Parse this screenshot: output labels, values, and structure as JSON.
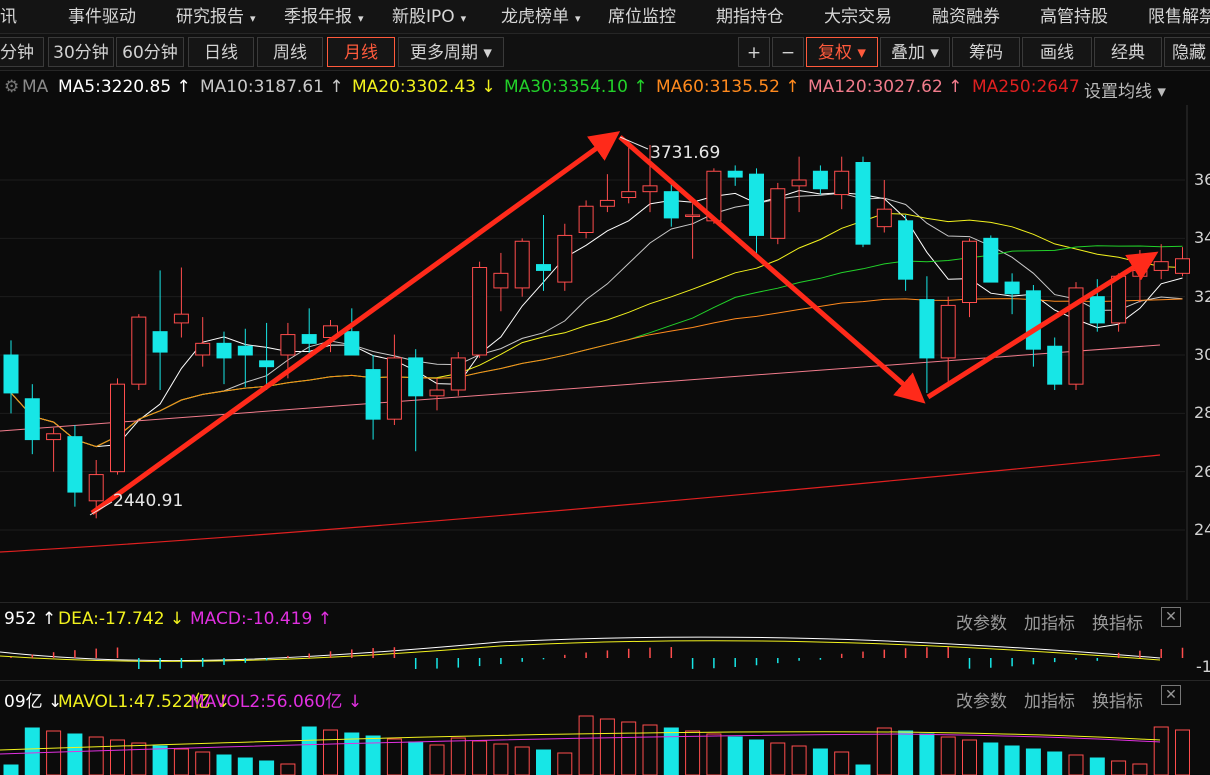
{
  "nav": {
    "items": [
      "讯",
      "事件驱动",
      "研究报告",
      "季报年报",
      "新股IPO",
      "龙虎榜单",
      "席位监控",
      "期指持仓",
      "大宗交易",
      "融资融券",
      "高管持股",
      "限售解禁"
    ],
    "dropdown_marker": "▾"
  },
  "toolbar": {
    "periods": [
      "分钟",
      "30分钟",
      "60分钟",
      "日线",
      "周线",
      "月线",
      "更多周期 ▾"
    ],
    "active_period": "月线",
    "right_buttons": [
      "+",
      "−",
      "复权 ▾",
      "叠加 ▾",
      "筹码",
      "画线",
      "经典",
      "隐藏"
    ]
  },
  "ma": {
    "label": "MA",
    "items": [
      {
        "text": "MA5:3220.85",
        "arrow": "↑",
        "color": "#ffffff"
      },
      {
        "text": "MA10:3187.61",
        "arrow": "↑",
        "color": "#c8c8c8"
      },
      {
        "text": "MA20:3302.43",
        "arrow": "↓",
        "color": "#f2f21e"
      },
      {
        "text": "MA30:3354.10",
        "arrow": "↑",
        "color": "#22d12a"
      },
      {
        "text": "MA60:3135.52",
        "arrow": "↑",
        "color": "#ff8a1e"
      },
      {
        "text": "MA120:3027.62",
        "arrow": "↑",
        "color": "#f27c8c"
      },
      {
        "text": "MA250:2647",
        "arrow": "",
        "color": "#e02020"
      }
    ],
    "settings": "设置均线 ▾"
  },
  "chart_data": {
    "type": "candlestick",
    "y_ticks": [
      "36",
      "34",
      "32",
      "30",
      "28",
      "26",
      "24"
    ],
    "high_label": "3731.69",
    "low_label": "2440.91",
    "up_color": "#ff4d4d",
    "down_color": "#17e6e6",
    "candles": [
      {
        "o": 3000,
        "h": 3050,
        "l": 2800,
        "c": 2870
      },
      {
        "o": 2850,
        "h": 2900,
        "l": 2660,
        "c": 2710
      },
      {
        "o": 2710,
        "h": 2750,
        "l": 2600,
        "c": 2730
      },
      {
        "o": 2720,
        "h": 2760,
        "l": 2480,
        "c": 2530
      },
      {
        "o": 2500,
        "h": 2640,
        "l": 2440,
        "c": 2590
      },
      {
        "o": 2600,
        "h": 2920,
        "l": 2590,
        "c": 2900
      },
      {
        "o": 2900,
        "h": 3140,
        "l": 2880,
        "c": 3130
      },
      {
        "o": 3080,
        "h": 3290,
        "l": 2880,
        "c": 3010
      },
      {
        "o": 3110,
        "h": 3300,
        "l": 3060,
        "c": 3140
      },
      {
        "o": 3000,
        "h": 3130,
        "l": 2960,
        "c": 3040
      },
      {
        "o": 3040,
        "h": 3080,
        "l": 2900,
        "c": 2990
      },
      {
        "o": 3030,
        "h": 3090,
        "l": 2890,
        "c": 3000
      },
      {
        "o": 2980,
        "h": 3110,
        "l": 2880,
        "c": 2960
      },
      {
        "o": 3000,
        "h": 3110,
        "l": 2920,
        "c": 3070
      },
      {
        "o": 3070,
        "h": 3160,
        "l": 3000,
        "c": 3040
      },
      {
        "o": 3060,
        "h": 3120,
        "l": 3010,
        "c": 3100
      },
      {
        "o": 3080,
        "h": 3160,
        "l": 3000,
        "c": 3000
      },
      {
        "o": 2950,
        "h": 3000,
        "l": 2710,
        "c": 2780
      },
      {
        "o": 2780,
        "h": 3070,
        "l": 2760,
        "c": 2990
      },
      {
        "o": 2990,
        "h": 3020,
        "l": 2670,
        "c": 2860
      },
      {
        "o": 2860,
        "h": 2920,
        "l": 2810,
        "c": 2880
      },
      {
        "o": 2880,
        "h": 3010,
        "l": 2860,
        "c": 2990
      },
      {
        "o": 3000,
        "h": 3320,
        "l": 2990,
        "c": 3300
      },
      {
        "o": 3230,
        "h": 3350,
        "l": 3150,
        "c": 3280
      },
      {
        "o": 3230,
        "h": 3400,
        "l": 3200,
        "c": 3390
      },
      {
        "o": 3310,
        "h": 3480,
        "l": 3220,
        "c": 3290
      },
      {
        "o": 3250,
        "h": 3450,
        "l": 3220,
        "c": 3410
      },
      {
        "o": 3420,
        "h": 3530,
        "l": 3400,
        "c": 3510
      },
      {
        "o": 3510,
        "h": 3620,
        "l": 3490,
        "c": 3530
      },
      {
        "o": 3540,
        "h": 3730,
        "l": 3520,
        "c": 3560
      },
      {
        "o": 3560,
        "h": 3720,
        "l": 3490,
        "c": 3580
      },
      {
        "o": 3560,
        "h": 3600,
        "l": 3440,
        "c": 3470
      },
      {
        "o": 3480,
        "h": 3520,
        "l": 3330,
        "c": 3480
      },
      {
        "o": 3460,
        "h": 3640,
        "l": 3450,
        "c": 3630
      },
      {
        "o": 3630,
        "h": 3650,
        "l": 3580,
        "c": 3610
      },
      {
        "o": 3620,
        "h": 3640,
        "l": 3340,
        "c": 3410
      },
      {
        "o": 3400,
        "h": 3590,
        "l": 3380,
        "c": 3570
      },
      {
        "o": 3580,
        "h": 3680,
        "l": 3490,
        "c": 3600
      },
      {
        "o": 3630,
        "h": 3650,
        "l": 3550,
        "c": 3570
      },
      {
        "o": 3550,
        "h": 3680,
        "l": 3500,
        "c": 3630
      },
      {
        "o": 3660,
        "h": 3680,
        "l": 3370,
        "c": 3380
      },
      {
        "o": 3440,
        "h": 3600,
        "l": 3420,
        "c": 3500
      },
      {
        "o": 3460,
        "h": 3480,
        "l": 3220,
        "c": 3260
      },
      {
        "o": 3190,
        "h": 3270,
        "l": 2870,
        "c": 2990
      },
      {
        "o": 2990,
        "h": 3200,
        "l": 2890,
        "c": 3170
      },
      {
        "o": 3180,
        "h": 3400,
        "l": 3130,
        "c": 3390
      },
      {
        "o": 3400,
        "h": 3410,
        "l": 3260,
        "c": 3250
      },
      {
        "o": 3250,
        "h": 3280,
        "l": 3140,
        "c": 3210
      },
      {
        "o": 3220,
        "h": 3240,
        "l": 2960,
        "c": 3020
      },
      {
        "o": 3030,
        "h": 3060,
        "l": 2880,
        "c": 2900
      },
      {
        "o": 2900,
        "h": 3250,
        "l": 2880,
        "c": 3230
      },
      {
        "o": 3200,
        "h": 3260,
        "l": 3080,
        "c": 3110
      },
      {
        "o": 3110,
        "h": 3280,
        "l": 3080,
        "c": 3270
      },
      {
        "o": 3270,
        "h": 3360,
        "l": 3180,
        "c": 3290
      },
      {
        "o": 3290,
        "h": 3380,
        "l": 3260,
        "c": 3320
      },
      {
        "o": 3280,
        "h": 3370,
        "l": 3270,
        "c": 3330
      }
    ]
  },
  "macd": {
    "items": [
      {
        "text": "952",
        "arrow": "↑",
        "color": "#ffffff"
      },
      {
        "text": "DEA:-17.742",
        "arrow": "↓",
        "color": "#f2f21e"
      },
      {
        "text": "MACD:-10.419",
        "arrow": "↑",
        "color": "#e030e0"
      }
    ],
    "buttons": [
      "改参数",
      "加指标",
      "换指标"
    ],
    "close": "✕",
    "y_label": "-1"
  },
  "vol": {
    "items": [
      {
        "text": "09亿",
        "arrow": "↓",
        "color": "#ffffff"
      },
      {
        "text": "MAVOL1:47.522亿",
        "arrow": "↓",
        "color": "#f2f21e"
      },
      {
        "text": "MAVOL2:56.060亿",
        "arrow": "↓",
        "color": "#e030e0"
      }
    ],
    "buttons": [
      "改参数",
      "加指标",
      "换指标"
    ],
    "close": "✕"
  }
}
